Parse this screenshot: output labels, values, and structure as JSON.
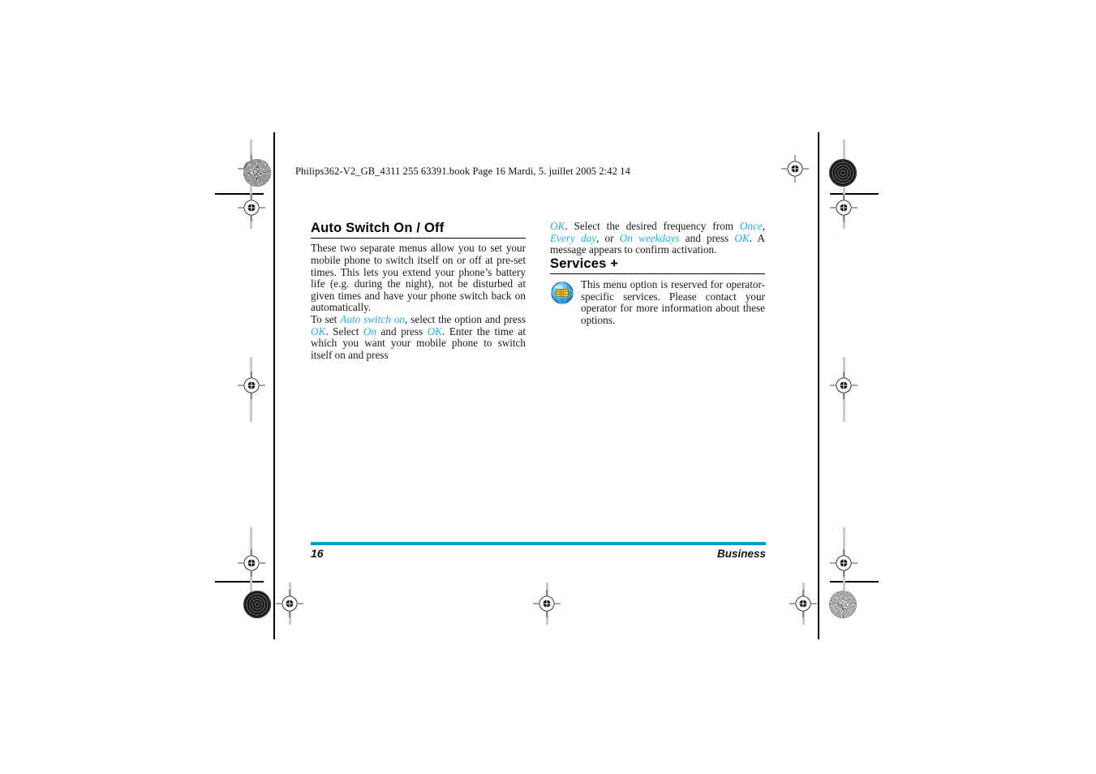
{
  "document": {
    "header_line": "Philips362-V2_GB_4311 255 63391.book  Page 16  Mardi, 5. juillet 2005  2:42 14",
    "accent_color": "#29ABE2",
    "footer_rule_color": "#0099DD"
  },
  "left_column": {
    "heading": "Auto Switch On / Off",
    "paragraph_1": "These two separate menus allow you to set your mobile phone to switch itself on or off at pre-set times. This lets you extend your phone’s battery life (e.g. during the night), not be disturbed at given times and have your phone switch back on automatically.",
    "paragraph_2_parts": {
      "t1": "To set ",
      "ui1": "Auto switch on",
      "t2": ", select the option and press ",
      "ui2": "OK",
      "t3": ". Select ",
      "ui3": "On",
      "t4": " and press ",
      "ui4": "OK",
      "t5": ". Enter the time at which you want your mobile phone to switch itself on and press"
    }
  },
  "right_column": {
    "lead_parts": {
      "ui1": "OK",
      "t1": ". Select the desired frequency from ",
      "ui2": "Once",
      "t2": ", ",
      "ui3": "Every day",
      "t3": ", or ",
      "ui4": "On weekdays",
      "t4": " and press ",
      "ui5": "OK",
      "t5": ". A message appears to confirm activation."
    },
    "heading": "Services +",
    "icon_name": "globe-sim-services-icon",
    "paragraph": "This menu option is reserved for operator-specific services. Please contact your operator for more information about these options."
  },
  "footer": {
    "page_number": "16",
    "chapter": "Business"
  }
}
